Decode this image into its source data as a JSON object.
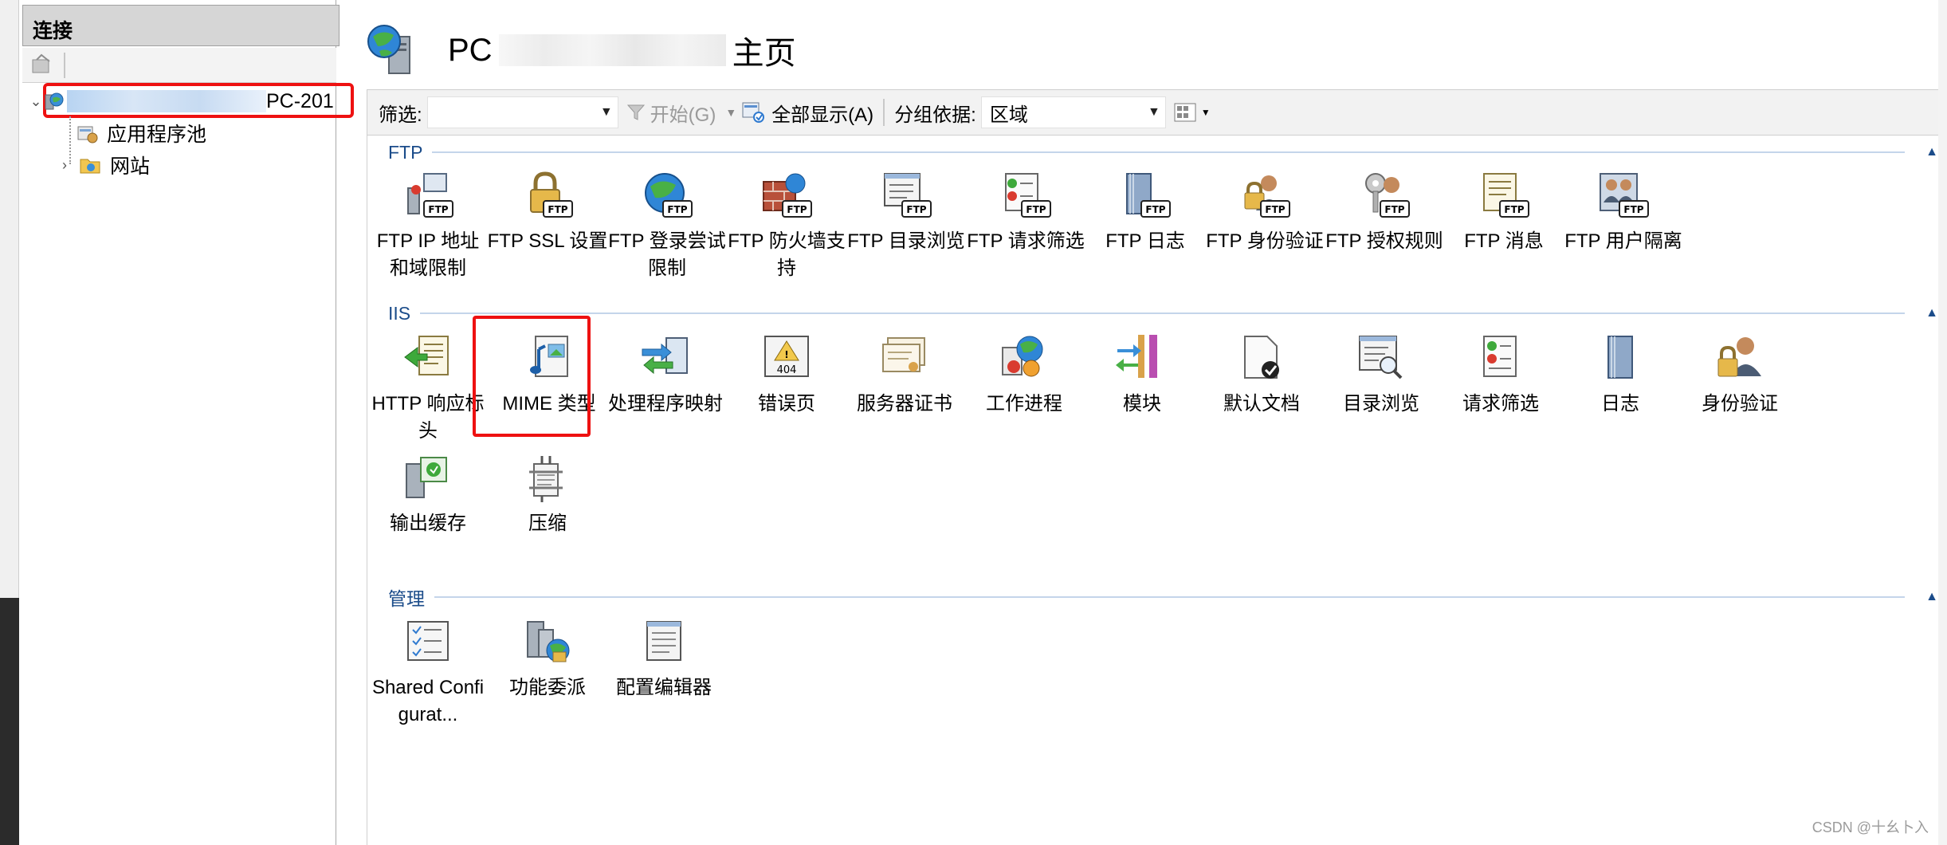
{
  "connections": {
    "header": "连接",
    "server_suffix": "PC-201",
    "tree": {
      "app_pools": "应用程序池",
      "sites": "网站"
    }
  },
  "main": {
    "title_prefix": "PC",
    "title_suffix": "主页"
  },
  "filter_bar": {
    "filter_label": "筛选:",
    "start_label": "开始(G)",
    "show_all_label": "全部显示(A)",
    "group_by_label": "分组依据:",
    "group_by_value": "区域"
  },
  "groups": {
    "ftp": {
      "label": "FTP",
      "items": [
        {
          "label": "FTP IP 地址和域限制",
          "icon": "ftp-ip-restrictions-icon"
        },
        {
          "label": "FTP SSL 设置",
          "icon": "ftp-ssl-icon"
        },
        {
          "label": "FTP 登录尝试限制",
          "icon": "ftp-logon-attempts-icon"
        },
        {
          "label": "FTP 防火墙支持",
          "icon": "ftp-firewall-icon"
        },
        {
          "label": "FTP 目录浏览",
          "icon": "ftp-directory-browsing-icon"
        },
        {
          "label": "FTP 请求筛选",
          "icon": "ftp-request-filtering-icon"
        },
        {
          "label": "FTP 日志",
          "icon": "ftp-logging-icon"
        },
        {
          "label": "FTP 身份验证",
          "icon": "ftp-authentication-icon"
        },
        {
          "label": "FTP 授权规则",
          "icon": "ftp-authorization-icon"
        },
        {
          "label": "FTP 消息",
          "icon": "ftp-messages-icon"
        },
        {
          "label": "FTP 用户隔离",
          "icon": "ftp-user-isolation-icon"
        }
      ]
    },
    "iis": {
      "label": "IIS",
      "items": [
        {
          "label": "HTTP 响应标头",
          "icon": "http-response-headers-icon"
        },
        {
          "label": "MIME 类型",
          "icon": "mime-types-icon"
        },
        {
          "label": "处理程序映射",
          "icon": "handler-mappings-icon"
        },
        {
          "label": "错误页",
          "icon": "error-pages-icon"
        },
        {
          "label": "服务器证书",
          "icon": "server-certificates-icon"
        },
        {
          "label": "工作进程",
          "icon": "worker-processes-icon"
        },
        {
          "label": "模块",
          "icon": "modules-icon"
        },
        {
          "label": "默认文档",
          "icon": "default-document-icon"
        },
        {
          "label": "目录浏览",
          "icon": "directory-browsing-icon"
        },
        {
          "label": "请求筛选",
          "icon": "request-filtering-icon"
        },
        {
          "label": "日志",
          "icon": "logging-icon"
        },
        {
          "label": "身份验证",
          "icon": "authentication-icon"
        },
        {
          "label": "输出缓存",
          "icon": "output-caching-icon"
        },
        {
          "label": "压缩",
          "icon": "compression-icon"
        }
      ]
    },
    "management": {
      "label": "管理",
      "items": [
        {
          "label": "Shared Configurat...",
          "icon": "shared-configuration-icon"
        },
        {
          "label": "功能委派",
          "icon": "feature-delegation-icon"
        },
        {
          "label": "配置编辑器",
          "icon": "configuration-editor-icon"
        }
      ]
    }
  },
  "watermark": "CSDN @十幺卜入",
  "colors": {
    "group_header": "#1b4c8a",
    "highlight_red": "#ee1111"
  }
}
